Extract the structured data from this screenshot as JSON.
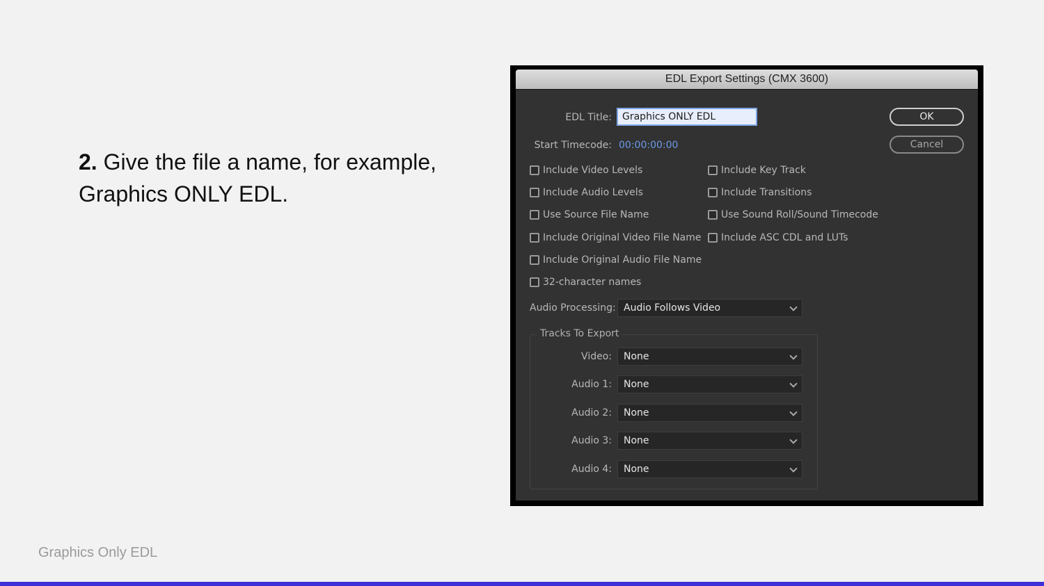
{
  "slide": {
    "step_number": "2.",
    "step_text": "Give the file a name, for example, Graphics ONLY EDL.",
    "footer": "Graphics Only EDL",
    "accent_color": "#3f2fd6"
  },
  "dialog": {
    "title": "EDL Export Settings (CMX 3600)",
    "edl_title_label": "EDL Title:",
    "edl_title_value": "Graphics ONLY EDL",
    "start_timecode_label": "Start Timecode:",
    "start_timecode_value": "00:00:00:00",
    "ok_label": "OK",
    "cancel_label": "Cancel",
    "checkboxes_left": [
      {
        "label": "Include Video Levels",
        "checked": false
      },
      {
        "label": "Include Audio Levels",
        "checked": false
      },
      {
        "label": "Use Source File Name",
        "checked": false
      },
      {
        "label": "Include Original Video File Name",
        "checked": false
      },
      {
        "label": "Include Original Audio File Name",
        "checked": false
      },
      {
        "label": "32-character names",
        "checked": false
      }
    ],
    "checkboxes_right": [
      {
        "label": "Include Key Track",
        "checked": false
      },
      {
        "label": "Include Transitions",
        "checked": false
      },
      {
        "label": "Use Sound Roll/Sound Timecode",
        "checked": false
      },
      {
        "label": "Include ASC CDL and LUTs",
        "checked": false
      }
    ],
    "audio_processing_label": "Audio Processing:",
    "audio_processing_value": "Audio Follows Video",
    "tracks_group_label": "Tracks To Export",
    "tracks": [
      {
        "label": "Video:",
        "value": "None"
      },
      {
        "label": "Audio 1:",
        "value": "None"
      },
      {
        "label": "Audio 2:",
        "value": "None"
      },
      {
        "label": "Audio 3:",
        "value": "None"
      },
      {
        "label": "Audio 4:",
        "value": "None"
      }
    ]
  }
}
